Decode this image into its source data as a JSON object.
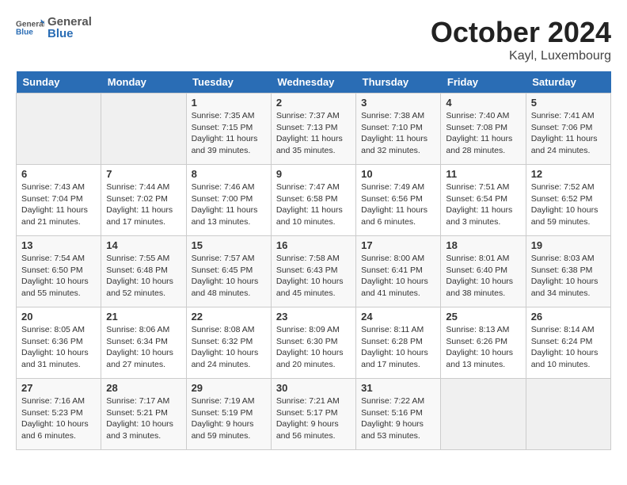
{
  "header": {
    "logo_text_general": "General",
    "logo_text_blue": "Blue",
    "month": "October 2024",
    "location": "Kayl, Luxembourg"
  },
  "weekdays": [
    "Sunday",
    "Monday",
    "Tuesday",
    "Wednesday",
    "Thursday",
    "Friday",
    "Saturday"
  ],
  "weeks": [
    [
      {
        "day": "",
        "info": ""
      },
      {
        "day": "",
        "info": ""
      },
      {
        "day": "1",
        "info": "Sunrise: 7:35 AM\nSunset: 7:15 PM\nDaylight: 11 hours and 39 minutes."
      },
      {
        "day": "2",
        "info": "Sunrise: 7:37 AM\nSunset: 7:13 PM\nDaylight: 11 hours and 35 minutes."
      },
      {
        "day": "3",
        "info": "Sunrise: 7:38 AM\nSunset: 7:10 PM\nDaylight: 11 hours and 32 minutes."
      },
      {
        "day": "4",
        "info": "Sunrise: 7:40 AM\nSunset: 7:08 PM\nDaylight: 11 hours and 28 minutes."
      },
      {
        "day": "5",
        "info": "Sunrise: 7:41 AM\nSunset: 7:06 PM\nDaylight: 11 hours and 24 minutes."
      }
    ],
    [
      {
        "day": "6",
        "info": "Sunrise: 7:43 AM\nSunset: 7:04 PM\nDaylight: 11 hours and 21 minutes."
      },
      {
        "day": "7",
        "info": "Sunrise: 7:44 AM\nSunset: 7:02 PM\nDaylight: 11 hours and 17 minutes."
      },
      {
        "day": "8",
        "info": "Sunrise: 7:46 AM\nSunset: 7:00 PM\nDaylight: 11 hours and 13 minutes."
      },
      {
        "day": "9",
        "info": "Sunrise: 7:47 AM\nSunset: 6:58 PM\nDaylight: 11 hours and 10 minutes."
      },
      {
        "day": "10",
        "info": "Sunrise: 7:49 AM\nSunset: 6:56 PM\nDaylight: 11 hours and 6 minutes."
      },
      {
        "day": "11",
        "info": "Sunrise: 7:51 AM\nSunset: 6:54 PM\nDaylight: 11 hours and 3 minutes."
      },
      {
        "day": "12",
        "info": "Sunrise: 7:52 AM\nSunset: 6:52 PM\nDaylight: 10 hours and 59 minutes."
      }
    ],
    [
      {
        "day": "13",
        "info": "Sunrise: 7:54 AM\nSunset: 6:50 PM\nDaylight: 10 hours and 55 minutes."
      },
      {
        "day": "14",
        "info": "Sunrise: 7:55 AM\nSunset: 6:48 PM\nDaylight: 10 hours and 52 minutes."
      },
      {
        "day": "15",
        "info": "Sunrise: 7:57 AM\nSunset: 6:45 PM\nDaylight: 10 hours and 48 minutes."
      },
      {
        "day": "16",
        "info": "Sunrise: 7:58 AM\nSunset: 6:43 PM\nDaylight: 10 hours and 45 minutes."
      },
      {
        "day": "17",
        "info": "Sunrise: 8:00 AM\nSunset: 6:41 PM\nDaylight: 10 hours and 41 minutes."
      },
      {
        "day": "18",
        "info": "Sunrise: 8:01 AM\nSunset: 6:40 PM\nDaylight: 10 hours and 38 minutes."
      },
      {
        "day": "19",
        "info": "Sunrise: 8:03 AM\nSunset: 6:38 PM\nDaylight: 10 hours and 34 minutes."
      }
    ],
    [
      {
        "day": "20",
        "info": "Sunrise: 8:05 AM\nSunset: 6:36 PM\nDaylight: 10 hours and 31 minutes."
      },
      {
        "day": "21",
        "info": "Sunrise: 8:06 AM\nSunset: 6:34 PM\nDaylight: 10 hours and 27 minutes."
      },
      {
        "day": "22",
        "info": "Sunrise: 8:08 AM\nSunset: 6:32 PM\nDaylight: 10 hours and 24 minutes."
      },
      {
        "day": "23",
        "info": "Sunrise: 8:09 AM\nSunset: 6:30 PM\nDaylight: 10 hours and 20 minutes."
      },
      {
        "day": "24",
        "info": "Sunrise: 8:11 AM\nSunset: 6:28 PM\nDaylight: 10 hours and 17 minutes."
      },
      {
        "day": "25",
        "info": "Sunrise: 8:13 AM\nSunset: 6:26 PM\nDaylight: 10 hours and 13 minutes."
      },
      {
        "day": "26",
        "info": "Sunrise: 8:14 AM\nSunset: 6:24 PM\nDaylight: 10 hours and 10 minutes."
      }
    ],
    [
      {
        "day": "27",
        "info": "Sunrise: 7:16 AM\nSunset: 5:23 PM\nDaylight: 10 hours and 6 minutes."
      },
      {
        "day": "28",
        "info": "Sunrise: 7:17 AM\nSunset: 5:21 PM\nDaylight: 10 hours and 3 minutes."
      },
      {
        "day": "29",
        "info": "Sunrise: 7:19 AM\nSunset: 5:19 PM\nDaylight: 9 hours and 59 minutes."
      },
      {
        "day": "30",
        "info": "Sunrise: 7:21 AM\nSunset: 5:17 PM\nDaylight: 9 hours and 56 minutes."
      },
      {
        "day": "31",
        "info": "Sunrise: 7:22 AM\nSunset: 5:16 PM\nDaylight: 9 hours and 53 minutes."
      },
      {
        "day": "",
        "info": ""
      },
      {
        "day": "",
        "info": ""
      }
    ]
  ]
}
